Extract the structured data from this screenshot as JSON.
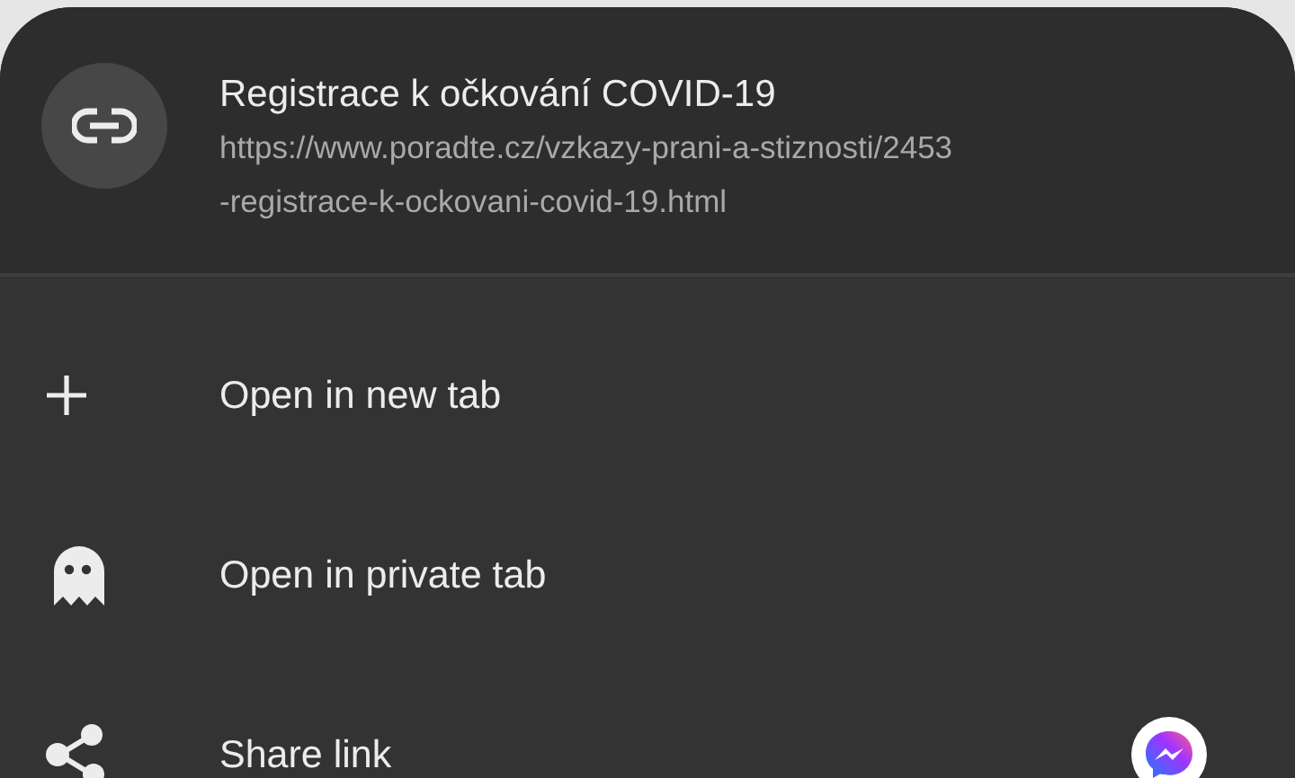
{
  "link": {
    "title": "Registrace k očkování COVID-19",
    "url_lines": [
      "https://www.poradte.cz/vzkazy-prani-a-stiznosti/2453",
      "-registrace-k-ockovani-covid-19.html"
    ]
  },
  "actions": [
    {
      "kind": "new-tab",
      "label": "Open in new tab"
    },
    {
      "kind": "private",
      "label": "Open in private tab"
    },
    {
      "kind": "share",
      "label": "Share link"
    }
  ]
}
